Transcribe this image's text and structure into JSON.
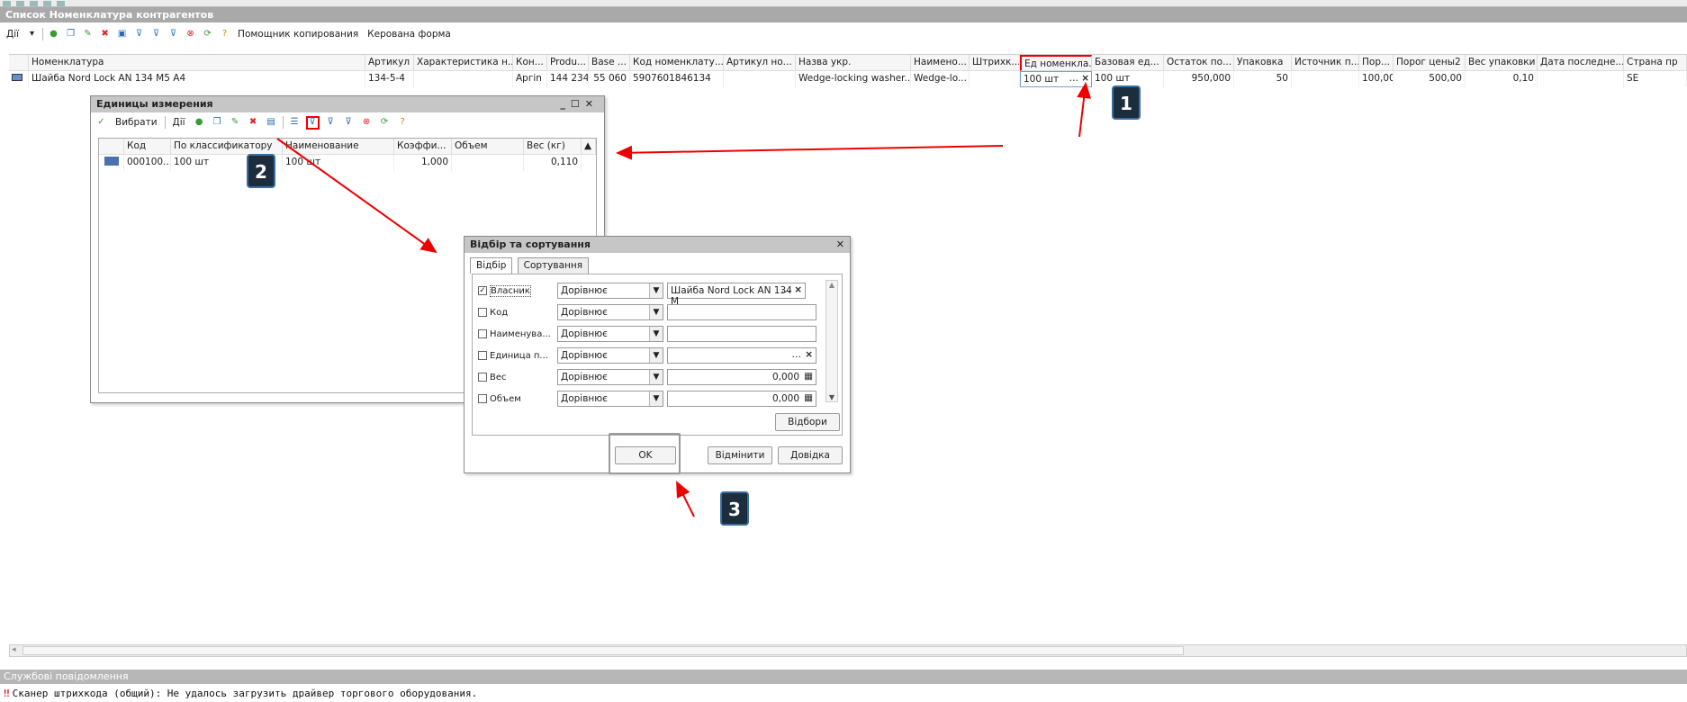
{
  "window": {
    "title": "Список Номенклатура контрагентов"
  },
  "toolbar": {
    "actions_label": "Дії",
    "copy_helper": "Помощник копирования",
    "managed_form": "Керована форма"
  },
  "grid": {
    "columns": [
      "Номенклатура",
      "Артикул",
      "Характеристика н...",
      "Кон...",
      "Produ...",
      "Base ...",
      "Код номенклату...",
      "Артикул но...",
      "Назва укр.",
      "Наимено...",
      "Штрихк...",
      "Ед номенкла...",
      "Базовая ед...",
      "Остаток по...",
      "Упаковка",
      "Источник п...",
      "Пор...",
      "Порог цены2",
      "Вес упаковки",
      "Дата последне...",
      "Страна пр"
    ],
    "row": [
      "Шайба Nord Lock AN 134 M5 A4",
      "134-5-4",
      "",
      "Apгin",
      "144 234",
      "55 060",
      "5907601846134",
      "",
      "Wedge-locking washer...",
      "Wedge-lo...",
      "",
      "100 шт",
      "100 шт",
      "950,000",
      "50",
      "",
      "100,00",
      "500,00",
      "0,10",
      "",
      "SE"
    ]
  },
  "units_window": {
    "title": "Единицы измерения",
    "choose_label": "Вибрати",
    "actions_label": "Дії",
    "columns": [
      "Код",
      "По классификатору",
      "Наименование",
      "Коэффи...",
      "Объем",
      "Вес (кг)"
    ],
    "row": [
      "000100...",
      "100 шт",
      "100 шт",
      "1,000",
      "",
      "0,110"
    ]
  },
  "filter_dialog": {
    "title": "Відбір та сортування",
    "tabs": [
      "Відбір",
      "Сортування"
    ],
    "rows": [
      {
        "label": "Власник",
        "checked": true,
        "op": "Дорівнює",
        "value": "Шайба Nord Lock AN 134 M"
      },
      {
        "label": "Код",
        "checked": false,
        "op": "Дорівнює",
        "value": ""
      },
      {
        "label": "Наименува...",
        "checked": false,
        "op": "Дорівнює",
        "value": ""
      },
      {
        "label": "Единица п...",
        "checked": false,
        "op": "Дорівнює",
        "value": ""
      },
      {
        "label": "Вес",
        "checked": false,
        "op": "Дорівнює",
        "value": "0,000"
      },
      {
        "label": "Объем",
        "checked": false,
        "op": "Дорівнює",
        "value": "0,000"
      }
    ],
    "filters_button": "Відбори",
    "ok_button": "OK",
    "cancel_button": "Відмінити",
    "help_button": "Довідка"
  },
  "annotations": {
    "one": "1",
    "two": "2",
    "three": "3"
  },
  "messages": {
    "title": "Службові повідомлення",
    "line": "Сканер штрихкода (общий): Не удалось загрузить драйвер торгового оборудования."
  },
  "colors": {
    "highlight": "#e00000",
    "marker": "#1c2d3e"
  }
}
